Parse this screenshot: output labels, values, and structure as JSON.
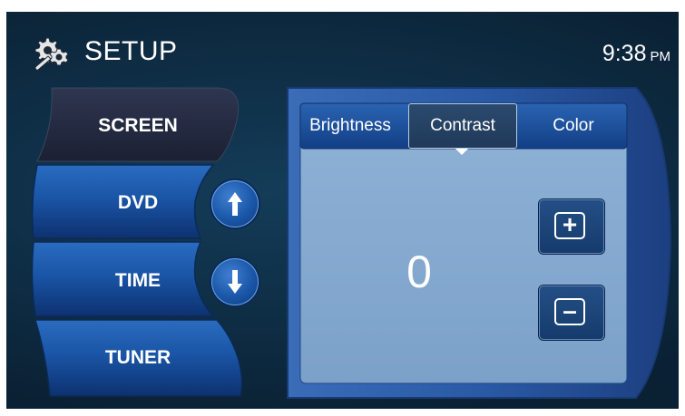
{
  "header": {
    "title": "SETUP",
    "time": "9:38",
    "ampm": "PM",
    "icon": "gear-wrench-icon"
  },
  "sidebar": {
    "items": [
      {
        "label": "SCREEN",
        "selected": true
      },
      {
        "label": "DVD",
        "selected": false
      },
      {
        "label": "TIME",
        "selected": false
      },
      {
        "label": "TUNER",
        "selected": false
      }
    ],
    "up_icon": "arrow-up-icon",
    "down_icon": "arrow-down-icon"
  },
  "panel": {
    "tabs": [
      {
        "label": "Brightness",
        "selected": false
      },
      {
        "label": "Contrast",
        "selected": true
      },
      {
        "label": "Color",
        "selected": false
      }
    ],
    "value": "0",
    "plus_label": "+",
    "minus_label": "–"
  },
  "colors": {
    "background": "#0e2d44",
    "panel_frame": "#2f5ca6",
    "panel_area": "#86a9cf",
    "tab_bar": "#1d4e98",
    "sidebar_button": "#1c5aa8",
    "sidebar_selected": "#232a3e"
  }
}
